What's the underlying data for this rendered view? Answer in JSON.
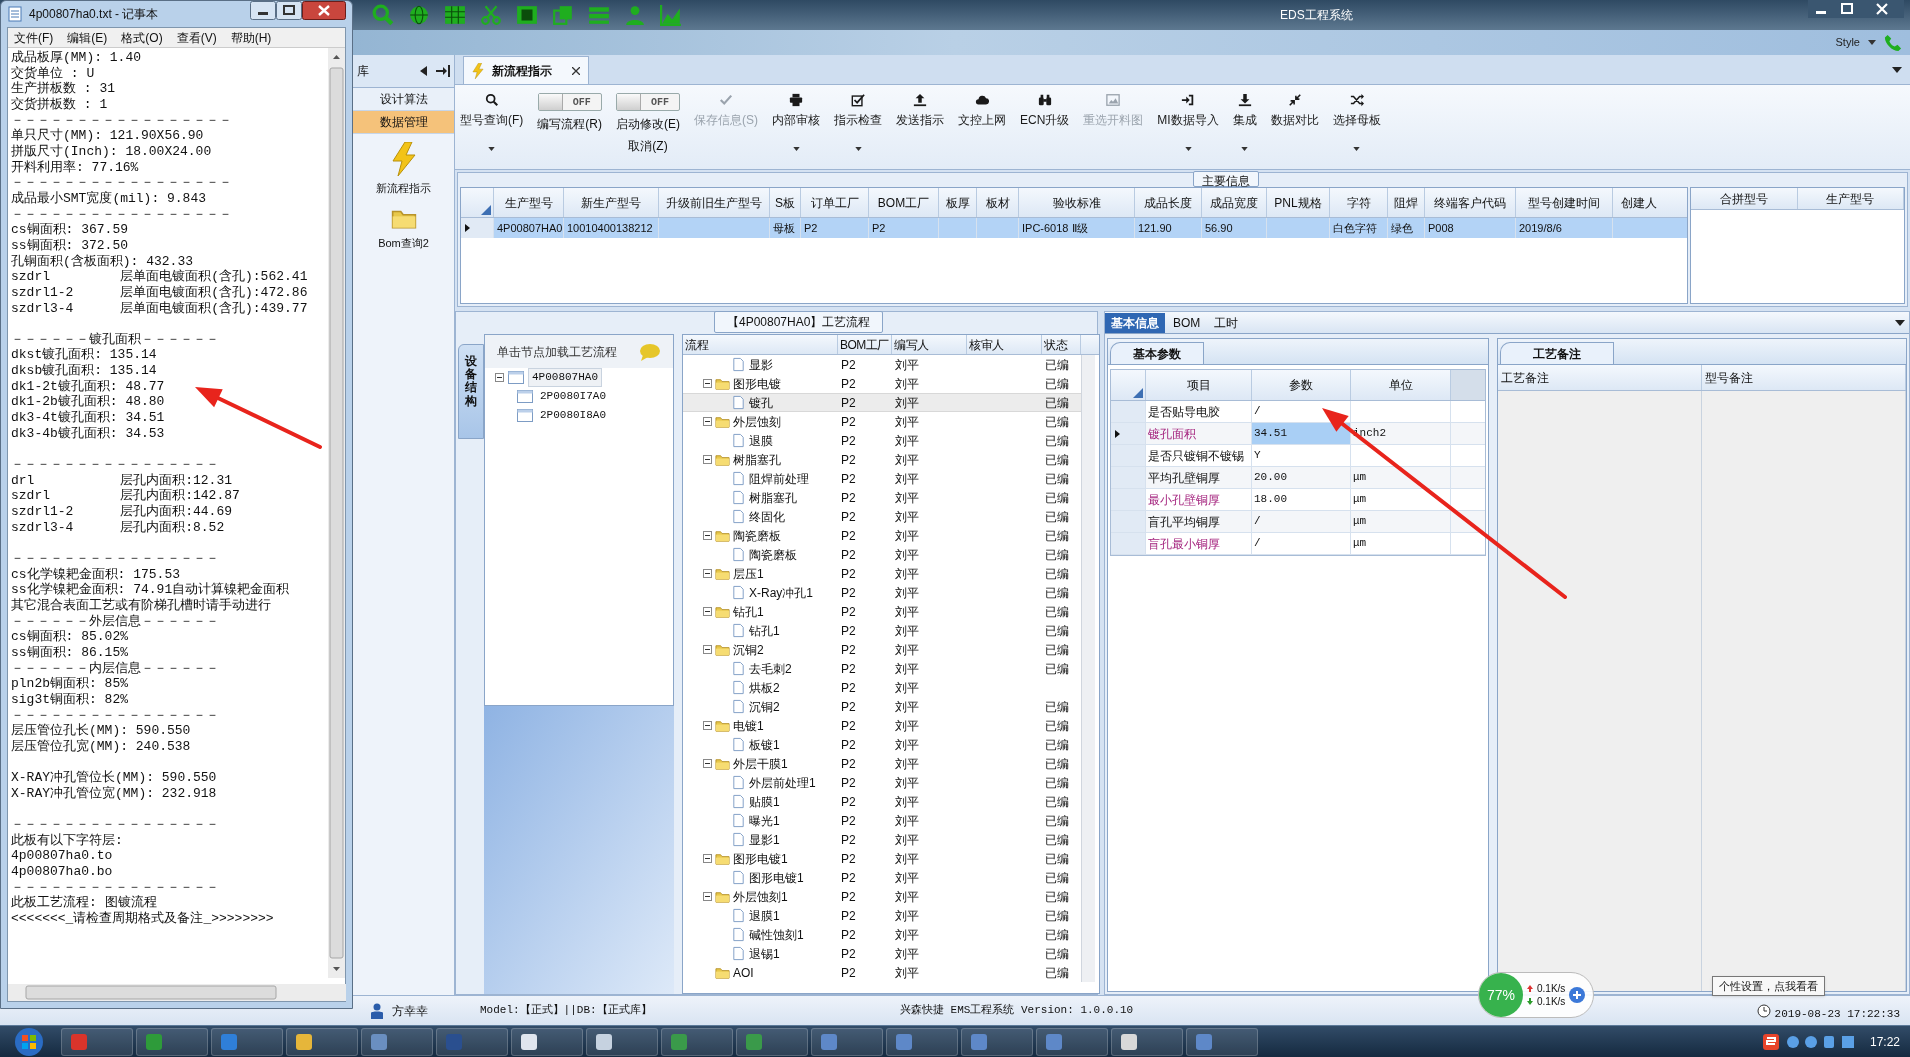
{
  "notepad": {
    "title": "4p00807ha0.txt - 记事本",
    "menu": [
      "文件(F)",
      "编辑(E)",
      "格式(O)",
      "查看(V)",
      "帮助(H)"
    ],
    "paragraphs": [
      [
        "成品板厚(MM): 1.40",
        "交货单位 : U",
        "生产拼板数 : 31",
        "交货拼板数 : 1",
        "－－－－－－－－－－－－－－－－－",
        "单只尺寸(MM): 121.90X56.90",
        "拼版尺寸(Inch): 18.00X24.00",
        "开料利用率: 77.16%",
        "－－－－－－－－－－－－－－－－－",
        "成品最小SMT宽度(mil): 9.843",
        "－－－－－－－－－－－－－－－－－",
        "cs铜面积: 367.59",
        "ss铜面积: 372.50",
        "孔铜面积(含板面积): 432.33",
        "szdrl         层单面电镀面积(含孔):562.41",
        "szdrl1-2      层单面电镀面积(含孔):472.86",
        "szdrl3-4      层单面电镀面积(含孔):439.77"
      ],
      [
        "－－－－－－镀孔面积－－－－－－",
        "dkst镀孔面积: 135.14",
        "dksb镀孔面积: 135.14",
        "dk1-2t镀孔面积: 48.77",
        "dk1-2b镀孔面积: 48.80",
        "dk3-4t镀孔面积: 34.51",
        "dk3-4b镀孔面积: 34.53"
      ],
      [
        "－－－－－－－－－－－－－－－－",
        "drl           层孔内面积:12.31",
        "szdrl         层孔内面积:142.87",
        "szdrl1-2      层孔内面积:44.69",
        "szdrl3-4      层孔内面积:8.52"
      ],
      [
        "－－－－－－－－－－－－－－－－",
        "cs化学镍耙金面积: 175.53",
        "ss化学镍耙金面积: 74.91自动计算镍耙金面积",
        "其它混合表面工艺或有阶梯孔槽时请手动进行",
        "－－－－－－外层信息－－－－－－",
        "cs铜面积: 85.02%",
        "ss铜面积: 86.15%",
        "－－－－－－内层信息－－－－－－",
        "pln2b铜面积: 85%",
        "sig3t铜面积: 82%",
        "－－－－－－－－－－－－－－－－",
        "层压管位孔长(MM): 590.550",
        "层压管位孔宽(MM): 240.538"
      ],
      [
        "X-RAY冲孔管位长(MM): 590.550",
        "X-RAY冲孔管位宽(MM): 232.918"
      ],
      [
        "－－－－－－－－－－－－－－－－",
        "此板有以下字符层:",
        "4p00807ha0.to",
        "4p00807ha0.bo",
        "－－－－－－－－－－－－－－－－",
        "此板工艺流程: 图镀流程",
        "<<<<<<<_请检查周期格式及备注_>>>>>>>>"
      ]
    ]
  },
  "app": {
    "title": "EDS工程系统",
    "style_label": "Style"
  },
  "nav": {
    "header": "库",
    "items": [
      {
        "label": "设计算法",
        "selected": false
      },
      {
        "label": "数据管理",
        "selected": true
      }
    ],
    "shortcuts": [
      {
        "label": "新流程指示",
        "kind": "lightning"
      },
      {
        "label": "Bom查询2",
        "kind": "folder"
      }
    ]
  },
  "doc_tab": {
    "label": "新流程指示"
  },
  "ribbon": [
    {
      "kind": "button",
      "label": "型号查询(F)",
      "disabled": false,
      "dropdown": true
    },
    {
      "kind": "toggle",
      "label": "编写流程(R)",
      "switch_text": "OFF",
      "on": false
    },
    {
      "kind": "toggle",
      "label": "启动修改(E)",
      "sub_label": "取消(Z)",
      "switch_text": "OFF",
      "on": false
    },
    {
      "kind": "button",
      "label": "保存信息(S)",
      "disabled": true,
      "dropdown": false
    },
    {
      "kind": "button",
      "label": "内部审核",
      "disabled": false,
      "dropdown": true
    },
    {
      "kind": "button",
      "label": "指示检查",
      "disabled": false,
      "dropdown": true
    },
    {
      "kind": "button",
      "label": "发送指示",
      "disabled": false,
      "dropdown": false
    },
    {
      "kind": "button",
      "label": "文控上网",
      "disabled": false,
      "dropdown": false
    },
    {
      "kind": "button",
      "label": "ECN升级",
      "disabled": false,
      "dropdown": false
    },
    {
      "kind": "button",
      "label": "重选开料图",
      "disabled": true,
      "dropdown": false
    },
    {
      "kind": "button",
      "label": "MI数据导入",
      "disabled": false,
      "dropdown": true
    },
    {
      "kind": "button",
      "label": "集成",
      "disabled": false,
      "dropdown": true
    },
    {
      "kind": "button",
      "label": "数据对比",
      "disabled": false,
      "dropdown": false
    },
    {
      "kind": "button",
      "label": "选择母板",
      "disabled": false,
      "dropdown": true
    }
  ],
  "main_info": {
    "title": "主要信息",
    "columns": [
      "生产型号",
      "新生产型号",
      "升级前旧生产型号",
      "S板",
      "订单工厂",
      "BOM工厂",
      "板厚",
      "板材",
      "验收标准",
      "成品长度",
      "成品宽度",
      "PNL规格",
      "字符",
      "阻焊",
      "终端客户代码",
      "型号创建时间",
      "创建人"
    ],
    "rows": [
      {
        "selected": true,
        "cells": [
          "4P00807HA0",
          "10010400138212",
          null,
          "母板",
          "P2",
          "P2",
          null,
          null,
          "IPC-6018 Ⅱ级",
          "121.90",
          "56.90",
          null,
          "白色字符",
          "绿色",
          "P008",
          "2019/8/6",
          null
        ]
      }
    ],
    "side_columns": [
      "合拼型号",
      "生产型号"
    ]
  },
  "process": {
    "title": "【4P00807HA0】工艺流程",
    "side_tab": "设备结构",
    "tree_hint": "单击节点加载工艺流程",
    "tree": [
      {
        "label": "4P00807HA0",
        "selected": true,
        "expanded": true,
        "children": [
          {
            "label": "2P0080I7A0",
            "selected": false
          },
          {
            "label": "2P0080I8A0",
            "selected": false
          }
        ]
      }
    ],
    "columns": [
      "流程",
      "BOM工厂",
      "编写人",
      "核审人",
      "状态"
    ],
    "rows": [
      {
        "kind": "continued",
        "children": [
          {
            "kind": "file",
            "name": "显影",
            "bom": "P2",
            "writer": "刘平",
            "status": "已编",
            "selected": false
          }
        ]
      },
      {
        "kind": "folder",
        "name": "图形电镀",
        "bom": "P2",
        "writer": "刘平",
        "status": "已编",
        "selected": false,
        "children": [
          {
            "kind": "file",
            "name": "镀孔",
            "bom": "P2",
            "writer": "刘平",
            "status": "已编",
            "selected": true
          }
        ]
      },
      {
        "kind": "folder",
        "name": "外层蚀刻",
        "bom": "P2",
        "writer": "刘平",
        "status": "已编",
        "selected": false,
        "children": [
          {
            "kind": "file",
            "name": "退膜",
            "bom": "P2",
            "writer": "刘平",
            "status": "已编",
            "selected": false
          }
        ]
      },
      {
        "kind": "folder",
        "name": "树脂塞孔",
        "bom": "P2",
        "writer": "刘平",
        "status": "已编",
        "selected": false,
        "children": [
          {
            "kind": "file",
            "name": "阻焊前处理",
            "bom": "P2",
            "writer": "刘平",
            "status": "已编",
            "selected": false
          },
          {
            "kind": "file",
            "name": "树脂塞孔",
            "bom": "P2",
            "writer": "刘平",
            "status": "已编",
            "selected": false
          },
          {
            "kind": "file",
            "name": "终固化",
            "bom": "P2",
            "writer": "刘平",
            "status": "已编",
            "selected": false
          }
        ]
      },
      {
        "kind": "folder",
        "name": "陶瓷磨板",
        "bom": "P2",
        "writer": "刘平",
        "status": "已编",
        "selected": false,
        "children": [
          {
            "kind": "file",
            "name": "陶瓷磨板",
            "bom": "P2",
            "writer": "刘平",
            "status": "已编",
            "selected": false
          }
        ]
      },
      {
        "kind": "folder",
        "name": "层压1",
        "bom": "P2",
        "writer": "刘平",
        "status": "已编",
        "selected": false,
        "children": [
          {
            "kind": "file",
            "name": "X-Ray冲孔1",
            "bom": "P2",
            "writer": "刘平",
            "status": "已编",
            "selected": false
          }
        ]
      },
      {
        "kind": "folder",
        "name": "钻孔1",
        "bom": "P2",
        "writer": "刘平",
        "status": "已编",
        "selected": false,
        "children": [
          {
            "kind": "file",
            "name": "钻孔1",
            "bom": "P2",
            "writer": "刘平",
            "status": "已编",
            "selected": false
          }
        ]
      },
      {
        "kind": "folder",
        "name": "沉铜2",
        "bom": "P2",
        "writer": "刘平",
        "status": "已编",
        "selected": false,
        "children": [
          {
            "kind": "file",
            "name": "去毛刺2",
            "bom": "P2",
            "writer": "刘平",
            "status": "已编",
            "selected": false
          },
          {
            "kind": "file",
            "name": "烘板2",
            "bom": "P2",
            "writer": "刘平",
            "selected": false
          },
          {
            "kind": "file",
            "name": "沉铜2",
            "bom": "P2",
            "writer": "刘平",
            "status": "已编",
            "selected": false
          }
        ]
      },
      {
        "kind": "folder",
        "name": "电镀1",
        "bom": "P2",
        "writer": "刘平",
        "status": "已编",
        "selected": false,
        "children": [
          {
            "kind": "file",
            "name": "板镀1",
            "bom": "P2",
            "writer": "刘平",
            "status": "已编",
            "selected": false
          }
        ]
      },
      {
        "kind": "folder",
        "name": "外层干膜1",
        "bom": "P2",
        "writer": "刘平",
        "status": "已编",
        "selected": false,
        "children": [
          {
            "kind": "file",
            "name": "外层前处理1",
            "bom": "P2",
            "writer": "刘平",
            "status": "已编",
            "selected": false
          },
          {
            "kind": "file",
            "name": "贴膜1",
            "bom": "P2",
            "writer": "刘平",
            "status": "已编",
            "selected": false
          },
          {
            "kind": "file",
            "name": "曝光1",
            "bom": "P2",
            "writer": "刘平",
            "status": "已编",
            "selected": false
          },
          {
            "kind": "file",
            "name": "显影1",
            "bom": "P2",
            "writer": "刘平",
            "status": "已编",
            "selected": false
          }
        ]
      },
      {
        "kind": "folder",
        "name": "图形电镀1",
        "bom": "P2",
        "writer": "刘平",
        "status": "已编",
        "selected": false,
        "children": [
          {
            "kind": "file",
            "name": "图形电镀1",
            "bom": "P2",
            "writer": "刘平",
            "status": "已编",
            "selected": false
          }
        ]
      },
      {
        "kind": "folder",
        "name": "外层蚀刻1",
        "bom": "P2",
        "writer": "刘平",
        "status": "已编",
        "selected": false,
        "children": [
          {
            "kind": "file",
            "name": "退膜1",
            "bom": "P2",
            "writer": "刘平",
            "status": "已编",
            "selected": false
          },
          {
            "kind": "file",
            "name": "碱性蚀刻1",
            "bom": "P2",
            "writer": "刘平",
            "status": "已编",
            "selected": false
          },
          {
            "kind": "file",
            "name": "退锡1",
            "bom": "P2",
            "writer": "刘平",
            "status": "已编",
            "selected": false
          }
        ]
      },
      {
        "kind": "folder",
        "name": "AOI",
        "bom": "P2",
        "writer": "刘平",
        "status": "已编",
        "selected": false
      }
    ]
  },
  "detail_tabs": [
    {
      "label": "基本信息",
      "selected": true
    },
    {
      "label": "BOM",
      "selected": false
    },
    {
      "label": "工时",
      "selected": false
    }
  ],
  "params": {
    "tab": "基本参数",
    "columns": [
      "项目",
      "参数",
      "单位"
    ],
    "rows": [
      {
        "item": "是否贴导电胶",
        "value": "/",
        "flagged": false,
        "selected": false
      },
      {
        "item": "镀孔面积",
        "value": "34.51",
        "unit": "inch2",
        "flagged": true,
        "selected": true
      },
      {
        "item": "是否只镀铜不镀锡",
        "value": "Y",
        "flagged": false,
        "selected": false
      },
      {
        "item": "平均孔壁铜厚",
        "value": "20.00",
        "unit": "μm",
        "flagged": false,
        "selected": false
      },
      {
        "item": "最小孔壁铜厚",
        "value": "18.00",
        "unit": "μm",
        "flagged": true,
        "selected": false
      },
      {
        "item": "盲孔平均铜厚",
        "value": "/",
        "unit": "μm",
        "flagged": false,
        "selected": false
      },
      {
        "item": "盲孔最小铜厚",
        "value": "/",
        "unit": "μm",
        "flagged": true,
        "selected": false
      }
    ]
  },
  "notes": {
    "tab": "工艺备注",
    "columns": [
      "工艺备注",
      "型号备注"
    ]
  },
  "status_bar": {
    "user": "方幸幸",
    "model": "Model:【正式】||DB:【正式库】",
    "version": "兴森快捷 EMS工程系统 Version: 1.0.0.10",
    "time": "2019-08-23 17:22:33"
  },
  "net_widget": {
    "percent": "77%",
    "up": "0.1K/s",
    "down": "0.1K/s"
  },
  "tooltip": "个性设置，点我看看",
  "taskbar": {
    "clock": "17:22"
  }
}
